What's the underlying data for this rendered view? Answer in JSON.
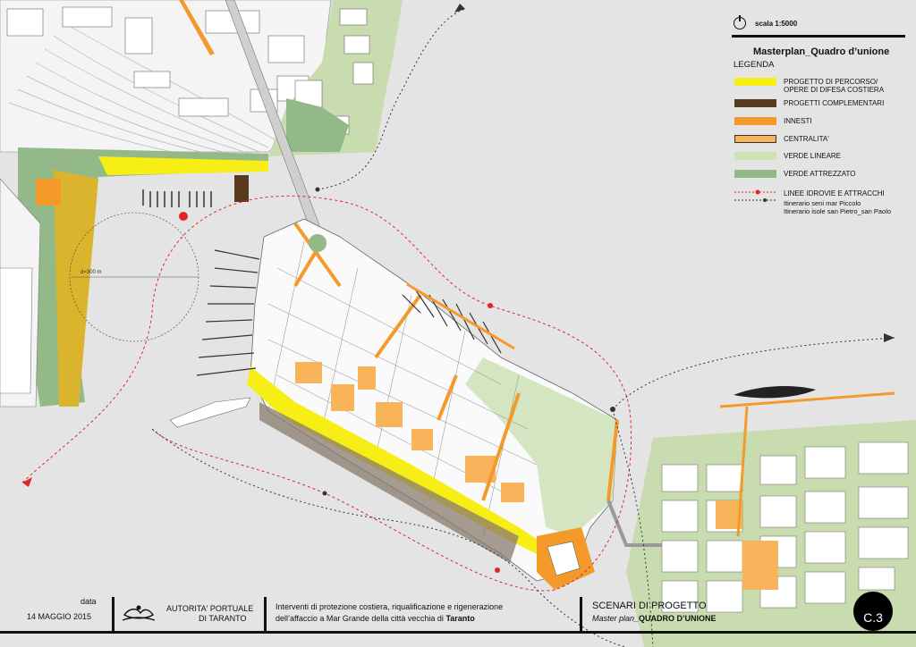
{
  "colors": {
    "background": "#e4e4e4",
    "percorso": "#f7ee16",
    "complementari": "#5a3a1e",
    "innesti": "#f39a2b",
    "centralita": "#f8b45a",
    "verde_lineare": "#cfe2b4",
    "verde_attrezzato": "#93b989",
    "route_red": "#e0262b",
    "route_black": "#333333"
  },
  "legend": {
    "scale": "scala 1:5000",
    "title": "Masterplan_Quadro d’unione",
    "subtitle": "LEGENDA",
    "items": [
      {
        "label": "PROGETTO DI PERCORSO/",
        "label2": "OPERE DI DIFESA COSTIERA",
        "color": "#f7ee16"
      },
      {
        "label": "PROGETTI COMPLEMENTARI",
        "color": "#5a3a1e"
      },
      {
        "label": "INNESTI",
        "color": "#f39a2b"
      },
      {
        "label": "CENTRALITA'",
        "color": "#f8b45a"
      },
      {
        "label": "VERDE LINEARE",
        "color": "#cfe2b4"
      },
      {
        "label": "VERDE ATTREZZATO",
        "color": "#93b989"
      }
    ],
    "routes": {
      "label": "LINEE IDROVIE  E ATTRACCHI",
      "line1": "Itinerario seni mar Piccolo",
      "line2": "Itinerario isole san Pietro_san Paolo"
    }
  },
  "map": {
    "distance_label": "d=300 m"
  },
  "footer": {
    "date_label": "data",
    "date_value": "14 MAGGIO 2015",
    "authority_line1": "AUTORITA' PORTUALE",
    "authority_line2": "DI TARANTO",
    "project_line1": "Interventi di protezione costiera, riqualificazione e rigenerazione",
    "project_line2": "dell’affaccio a Mar Grande della città vecchia di",
    "project_city": "Taranto",
    "scenario_title": "SCENARI DI PROGETTO",
    "scenario_sub": "Master plan_",
    "scenario_sub_bold": "QUADRO D’UNIONE",
    "sheet": "C.3"
  }
}
